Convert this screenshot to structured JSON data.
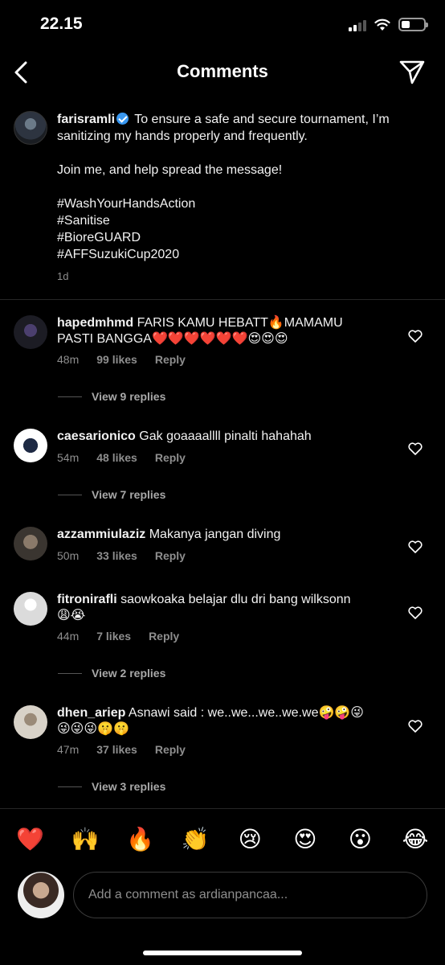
{
  "status": {
    "time": "22.15"
  },
  "header": {
    "title": "Comments"
  },
  "caption": {
    "username": "farisramli",
    "lines": [
      "To ensure a safe and secure tournament, I’m",
      "sanitizing my hands properly and frequently.",
      "Join me, and help spread the message!",
      "#WashYourHandsAction",
      "#Sanitise",
      "#BioreGUARD",
      "#AFFSuzukiCup2020"
    ],
    "age": "1d"
  },
  "comments": [
    {
      "username": "hapedmhmd",
      "text1": "FARIS KAMU HEBATT🔥MAMAMU",
      "text2": "PASTI BANGGA❤️❤️❤️❤️❤️❤️😍😍😍",
      "age": "48m",
      "likes": "99 likes",
      "reply": "Reply",
      "view_replies": "View 9 replies"
    },
    {
      "username": "caesarionico",
      "text1": "Gak goaaaallll pinalti hahahah",
      "text2": "",
      "age": "54m",
      "likes": "48 likes",
      "reply": "Reply",
      "view_replies": "View 7 replies"
    },
    {
      "username": "azzammiulaziz",
      "text1": "Makanya jangan diving",
      "text2": "",
      "age": "50m",
      "likes": "33 likes",
      "reply": "Reply",
      "view_replies": ""
    },
    {
      "username": "fitronirafli",
      "text1": "saowkoaka belajar dlu dri bang wilksonn",
      "text2": "😩😭",
      "age": "44m",
      "likes": "7 likes",
      "reply": "Reply",
      "view_replies": "View 2 replies"
    },
    {
      "username": "dhen_ariep",
      "text1": "Asnawi said : we..we...we..we.we🤪🤪😜",
      "text2": "😜😜😜🤫🤫",
      "age": "47m",
      "likes": "37 likes",
      "reply": "Reply",
      "view_replies": "View 3 replies"
    }
  ],
  "emoji_bar": [
    "❤️",
    "🙌",
    "🔥",
    "👏",
    "😢",
    "😍",
    "😮",
    "😂"
  ],
  "composer": {
    "placeholder": "Add a comment as ardianpancaa..."
  }
}
